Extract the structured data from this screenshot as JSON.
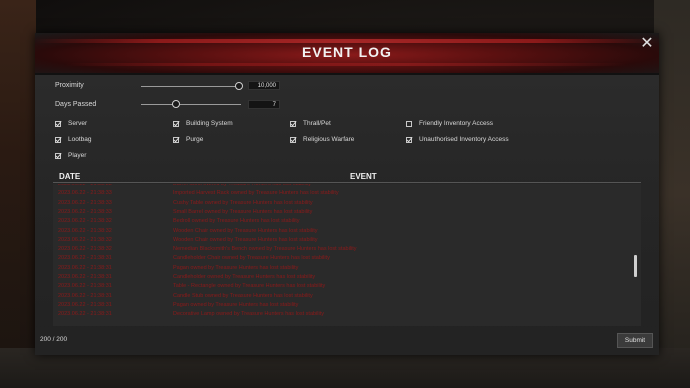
{
  "window": {
    "title": "EVENT LOG",
    "close_icon": "close-icon"
  },
  "filters": {
    "proximity": {
      "label": "Proximity",
      "value": "10,000",
      "level_fraction": 0.98
    },
    "days_passed": {
      "label": "Days Passed",
      "value": "7",
      "level_fraction": 0.35
    }
  },
  "checkboxes": [
    {
      "label": "Server",
      "checked": true
    },
    {
      "label": "Building System",
      "checked": true
    },
    {
      "label": "Thrall/Pet",
      "checked": true
    },
    {
      "label": "Friendly Inventory Access",
      "checked": false
    },
    {
      "label": "Lootbag",
      "checked": true
    },
    {
      "label": "Purge",
      "checked": true
    },
    {
      "label": "Religious Warfare",
      "checked": true
    },
    {
      "label": "Unauthorised Inventory Access",
      "checked": true
    },
    {
      "label": "Player",
      "checked": true
    }
  ],
  "table": {
    "headers": {
      "date": "DATE",
      "event": "EVENT"
    },
    "rows": [
      {
        "date": "2023.06.22 - 21:38:33",
        "event": "Barrel Stool owned by Treasure Hunters has lost stability"
      },
      {
        "date": "2023.06.22 - 21:38:33",
        "event": "Imported Harvest Rack owned by Treasure Hunters has lost stability"
      },
      {
        "date": "2023.06.22 - 21:38:33",
        "event": "Cushy Table owned by Treasure Hunters has lost stability"
      },
      {
        "date": "2023.06.22 - 21:38:33",
        "event": "Small Barrel owned by Treasure Hunters has lost stability"
      },
      {
        "date": "2023.06.22 - 21:38:32",
        "event": "Bedroll owned by Treasure Hunters has lost stability"
      },
      {
        "date": "2023.06.22 - 21:38:32",
        "event": "Wooden Chair owned by Treasure Hunters has lost stability"
      },
      {
        "date": "2023.06.22 - 21:38:32",
        "event": "Wooden Chair owned by Treasure Hunters has lost stability"
      },
      {
        "date": "2023.06.22 - 21:38:32",
        "event": "Nemedian Blacksmith's Bench owned by Treasure Hunters has lost stability"
      },
      {
        "date": "2023.06.22 - 21:38:31",
        "event": "Candleholder Chair owned by Treasure Hunters has lost stability"
      },
      {
        "date": "2023.06.22 - 21:38:31",
        "event": "Pagan owned by Treasure Hunters has lost stability"
      },
      {
        "date": "2023.06.22 - 21:38:31",
        "event": "Candleholder owned by Treasure Hunters has lost stability"
      },
      {
        "date": "2023.06.22 - 21:38:31",
        "event": "Table - Rectangle owned by Treasure Hunters has lost stability"
      },
      {
        "date": "2023.06.22 - 21:38:31",
        "event": "Candle Stub owned by Treasure Hunters has lost stability"
      },
      {
        "date": "2023.06.22 - 21:38:31",
        "event": "Pagan owned by Treasure Hunters has lost stability"
      },
      {
        "date": "2023.06.22 - 21:38:31",
        "event": "Decorative Lamp owned by Treasure Hunters has lost stability"
      }
    ]
  },
  "footer": {
    "count": "200 / 200",
    "submit_label": "Submit"
  },
  "colors": {
    "log_text": "#8c1a1a",
    "header_red": "#8a1a1a"
  }
}
